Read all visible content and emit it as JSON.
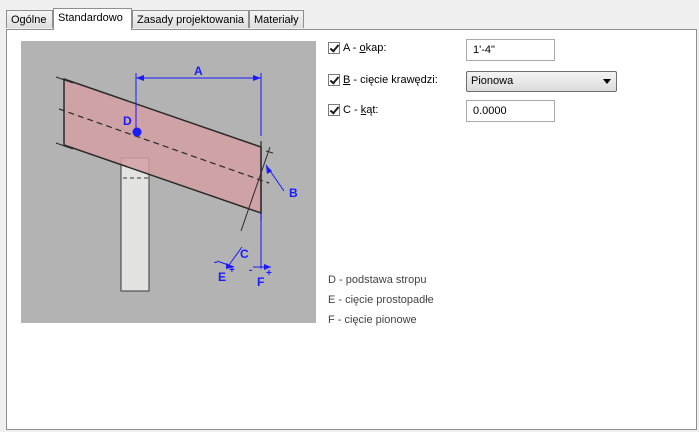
{
  "tabs": [
    {
      "label": "Ogólne"
    },
    {
      "label": "Standardowo"
    },
    {
      "label": "Zasady projektowania"
    },
    {
      "label": "Materiały"
    }
  ],
  "options": {
    "a": {
      "checked": true,
      "prefix": "A - ",
      "underline": "o",
      "rest": "kap:",
      "value": "1'-4\""
    },
    "b": {
      "checked": true,
      "underline": "B",
      "rest": " - cięcie krawędzi:",
      "selected": "Pionowa"
    },
    "c": {
      "checked": true,
      "prefix": "C - ",
      "underline": "k",
      "rest": "ąt:",
      "value": "0.0000"
    }
  },
  "legend": [
    {
      "text": "D - podstawa stropu"
    },
    {
      "text": "E - cięcie prostopadłe"
    },
    {
      "text": "F - cięcie pionowe"
    }
  ],
  "diagram": {
    "labels": {
      "a": "A",
      "b": "B",
      "c": "C",
      "d": "D",
      "e": "E",
      "f": "F",
      "minus": "-",
      "plus": "+"
    },
    "colors": {
      "background": "#b3b3b3",
      "rafter": "#d4a0a3",
      "post": "#e2e2e0",
      "annotation": "#1a1aff"
    }
  }
}
